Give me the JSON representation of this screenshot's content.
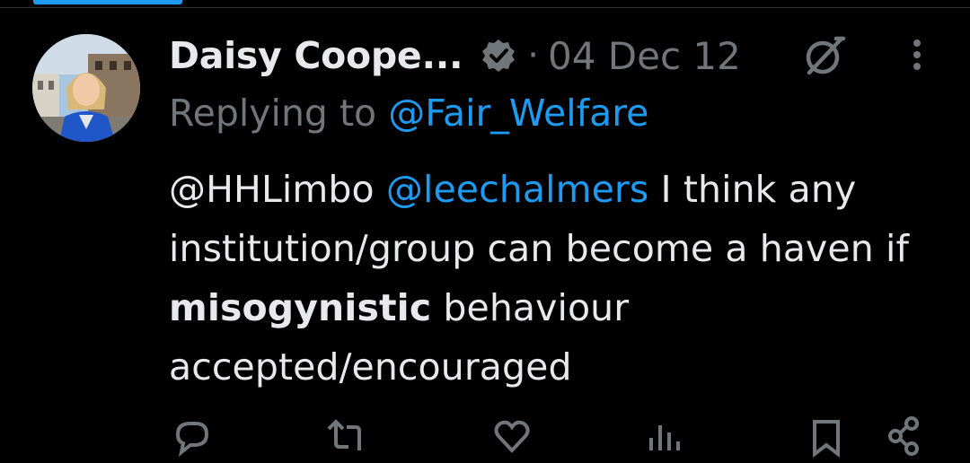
{
  "tweet": {
    "author_name": "Daisy Coope...",
    "separator": "·",
    "date": "04 Dec 12",
    "replying_prefix": "Replying to",
    "replying_to": "@Fair_Welfare",
    "body": {
      "mention_1": "@HHLimbo",
      "mention_2": "@leechalmers",
      "text_1": " I think any institution/group can become a haven if ",
      "emphasis": "misogynistic",
      "text_2": " behaviour accepted/encouraged"
    }
  },
  "icons": {
    "verified": "verified-badge-icon",
    "grok": "grok-icon",
    "more": "more-vertical-icon",
    "reply": "reply-icon",
    "retweet": "retweet-icon",
    "like": "like-icon",
    "views": "views-icon",
    "bookmark": "bookmark-icon",
    "share": "share-icon"
  },
  "colors": {
    "background": "#000000",
    "text": "#e7e9ea",
    "muted": "#71767b",
    "accent": "#1d9bf0"
  }
}
